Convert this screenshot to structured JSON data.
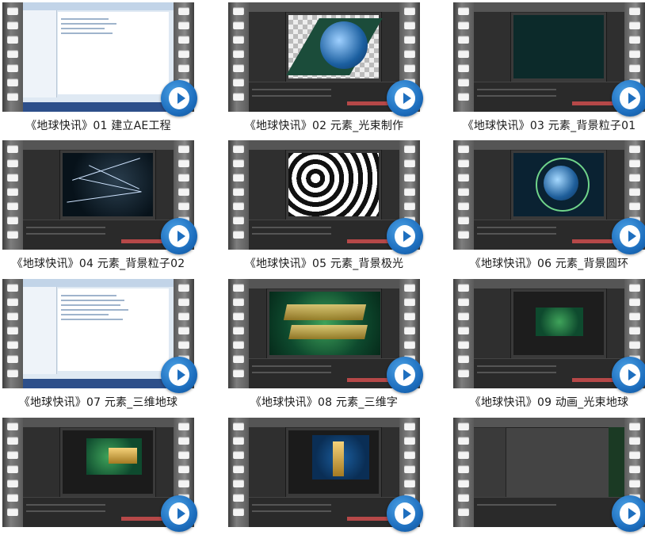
{
  "videos": [
    {
      "title": "《地球快讯》01 建立AE工程",
      "thumb": "explorer"
    },
    {
      "title": "《地球快讯》02 元素_光束制作",
      "thumb": "globe"
    },
    {
      "title": "《地球快讯》03 元素_背景粒子01",
      "thumb": "dark"
    },
    {
      "title": "《地球快讯》04 元素_背景粒子02",
      "thumb": "streaks"
    },
    {
      "title": "《地球快讯》05 元素_背景极光",
      "thumb": "noise"
    },
    {
      "title": "《地球快讯》06 元素_背景圆环",
      "thumb": "rings"
    },
    {
      "title": "《地球快讯》07 元素_三维地球",
      "thumb": "explorer"
    },
    {
      "title": "《地球快讯》08 元素_三维字",
      "thumb": "text3d"
    },
    {
      "title": "《地球快讯》09 动画_光束地球",
      "thumb": "globe-small"
    },
    {
      "title": "",
      "thumb": "text3d-small"
    },
    {
      "title": "",
      "thumb": "globe-gold"
    },
    {
      "title": "",
      "thumb": "settings"
    }
  ],
  "icons": {
    "play": "play-circle-icon"
  },
  "colors": {
    "play_blue": "#1e6fbf",
    "timeline_red": "#b64848",
    "film_gray": "#6a6a6a"
  }
}
